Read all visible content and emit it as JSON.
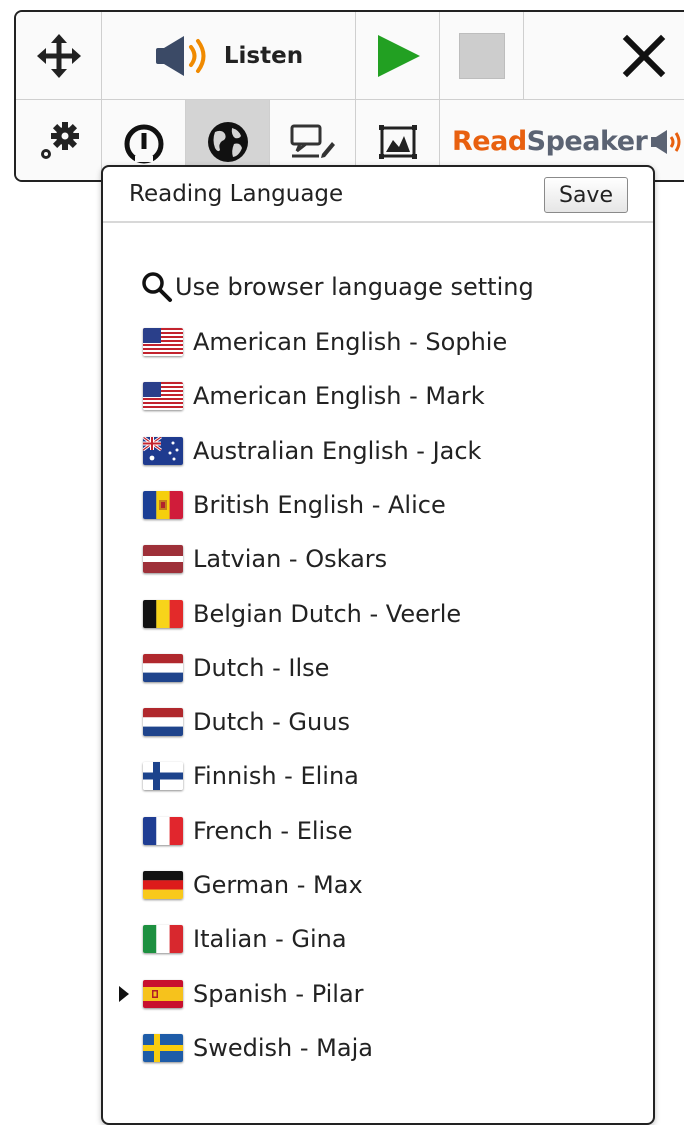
{
  "toolbar": {
    "listen_label": "Listen",
    "logo_read": "Read",
    "logo_speaker": "Speaker",
    "accent_play": "#22a022",
    "accent_logo": "#e8600f",
    "icons": [
      "move-icon",
      "speaker-icon",
      "play-icon",
      "stop-icon",
      "close-icon",
      "settings-icon",
      "speed-icon",
      "globe-icon",
      "text-settings-icon",
      "image-icon",
      "readspeaker-speaker-icon"
    ]
  },
  "panel": {
    "title": "Reading Language",
    "save_label": "Save",
    "browser_option": "Use browser language setting",
    "selected_index": 12,
    "languages": [
      {
        "label": "American English - Sophie",
        "flag": "us"
      },
      {
        "label": "American English - Mark",
        "flag": "us"
      },
      {
        "label": "Australian English - Jack",
        "flag": "au"
      },
      {
        "label": "British English - Alice",
        "flag": "ad"
      },
      {
        "label": "Latvian - Oskars",
        "flag": "lv"
      },
      {
        "label": "Belgian Dutch - Veerle",
        "flag": "be"
      },
      {
        "label": "Dutch - Ilse",
        "flag": "nl"
      },
      {
        "label": "Dutch - Guus",
        "flag": "nl"
      },
      {
        "label": "Finnish - Elina",
        "flag": "fi"
      },
      {
        "label": "French - Elise",
        "flag": "fr"
      },
      {
        "label": "German - Max",
        "flag": "de"
      },
      {
        "label": "Italian - Gina",
        "flag": "it"
      },
      {
        "label": "Spanish - Pilar",
        "flag": "es"
      },
      {
        "label": "Swedish - Maja",
        "flag": "se"
      }
    ]
  }
}
